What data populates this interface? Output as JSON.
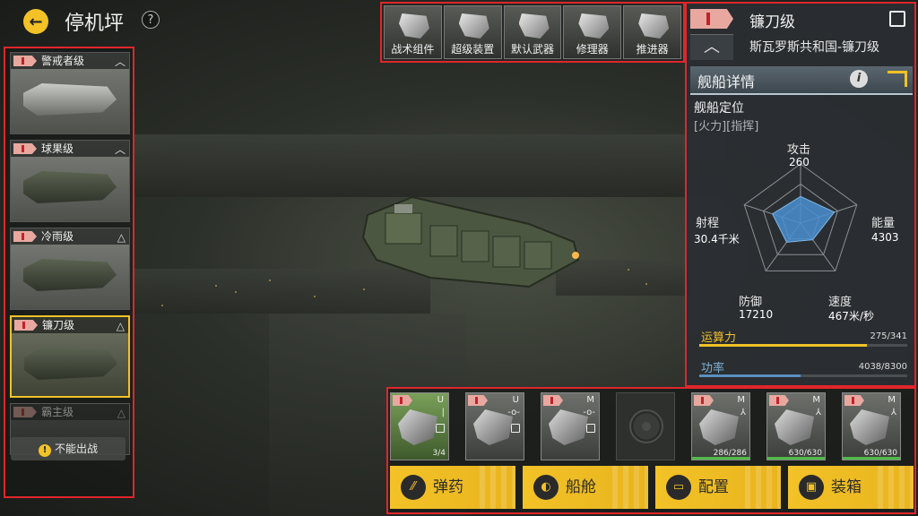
{
  "header": {
    "back_icon": "back-arrow-icon",
    "title": "停机坪",
    "help": "?"
  },
  "ship_list": [
    {
      "name": "警戒者级",
      "selected": false
    },
    {
      "name": "球果级",
      "selected": false
    },
    {
      "name": "冷雨级",
      "selected": false
    },
    {
      "name": "镰刀级",
      "selected": true
    },
    {
      "name": "霸主级",
      "selected": false,
      "disabled": true
    }
  ],
  "cannot_deploy": "不能出战",
  "equipment_tabs": [
    "战术组件",
    "超级装置",
    "默认武器",
    "修理器",
    "推进器"
  ],
  "ship_info": {
    "name": "镰刀级",
    "faction": "斯瓦罗斯共和国-镰刀级",
    "detail_title": "舰船详情",
    "info": "i",
    "position_title": "舰船定位",
    "position_tags": "[火力][指挥]"
  },
  "stats": {
    "attack_label": "攻击",
    "attack": "260",
    "energy_label": "能量",
    "energy": "4303",
    "speed_label": "速度",
    "speed": "467米/秒",
    "defense_label": "防御",
    "defense": "17210",
    "range_label": "射程",
    "range": "30.4千米"
  },
  "chart_data": {
    "type": "radar",
    "axes": [
      "攻击",
      "能量",
      "速度",
      "防御",
      "射程"
    ],
    "values": [
      0.45,
      0.6,
      0.35,
      0.4,
      0.5
    ]
  },
  "bars": {
    "compute_label": "运算力",
    "compute_value": "275/341",
    "compute_fraction": 0.806,
    "power_label": "功率",
    "power_value": "4038/8300",
    "power_fraction": 0.486
  },
  "modules": [
    {
      "tier": "I",
      "type": "U",
      "mark": "|",
      "count": "3/4",
      "style": "green"
    },
    {
      "tier": "I",
      "type": "U",
      "mark": "-o-",
      "count": "",
      "style": "normal"
    },
    {
      "tier": "I",
      "type": "M",
      "mark": "-o-",
      "count": "",
      "style": "normal"
    },
    {
      "tier": "",
      "type": "",
      "mark": "",
      "count": "",
      "style": "empty"
    },
    {
      "tier": "I",
      "type": "M",
      "mark": "⅄",
      "count": "286/286",
      "style": "normal"
    },
    {
      "tier": "I",
      "type": "M",
      "mark": "⅄",
      "count": "630/630",
      "style": "normal"
    },
    {
      "tier": "I",
      "type": "M",
      "mark": "⅄",
      "count": "630/630",
      "style": "normal"
    }
  ],
  "actions": [
    "弹药",
    "船舱",
    "配置",
    "装箱"
  ],
  "colors": {
    "accent": "#f2c227",
    "highlight_box": "#e0262b",
    "compute_bar": "#f2c227",
    "power_bar": "#5a8fc0"
  }
}
